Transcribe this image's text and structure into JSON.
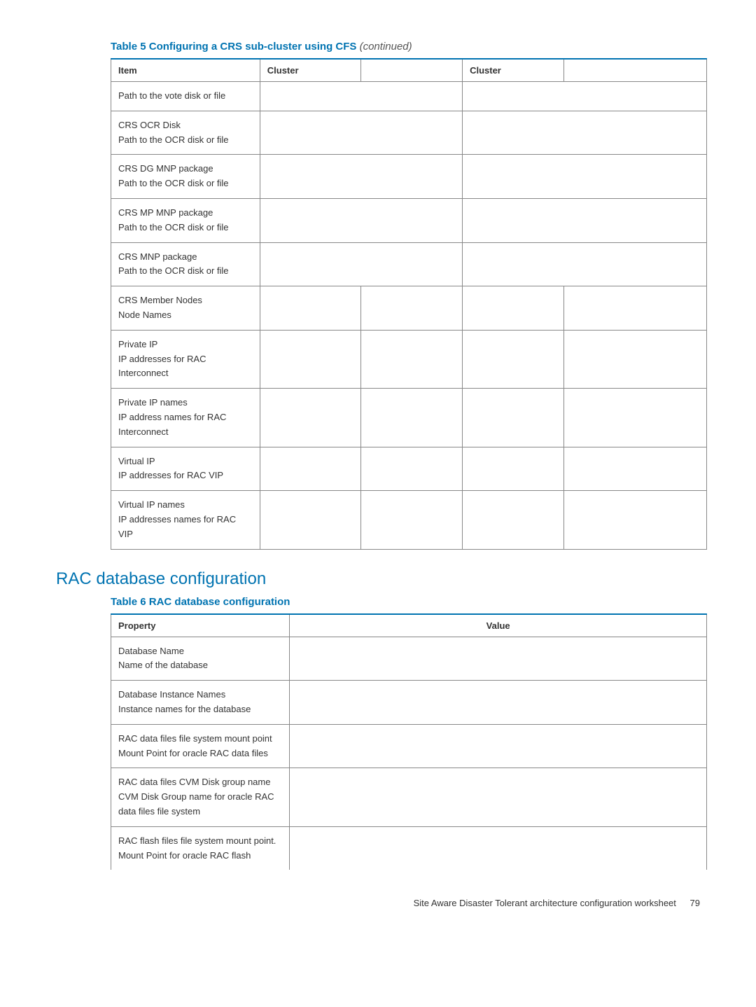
{
  "table5": {
    "caption": "Table 5 Configuring a CRS sub-cluster using CFS",
    "continued": "(continued)",
    "headers": {
      "item": "Item",
      "cluster1": "Cluster",
      "cluster2": "Cluster"
    },
    "rows": [
      {
        "main": "",
        "sub": "Path to the vote disk or file"
      },
      {
        "main": "CRS OCR Disk",
        "sub": "Path to the OCR disk or file"
      },
      {
        "main": "CRS DG MNP package",
        "sub": "Path to the OCR disk or file"
      },
      {
        "main": "CRS MP MNP package",
        "sub": "Path to the OCR disk or file"
      },
      {
        "main": "CRS MNP package",
        "sub": "Path to the OCR disk or file"
      },
      {
        "main": "CRS Member Nodes",
        "sub": "Node Names"
      },
      {
        "main": "Private IP",
        "sub": "IP addresses for RAC Interconnect"
      },
      {
        "main": "Private IP names",
        "sub": "IP address names for RAC Interconnect"
      },
      {
        "main": "Virtual IP",
        "sub": "IP addresses for RAC VIP"
      },
      {
        "main": "Virtual IP names",
        "sub": "IP addresses names for RAC VIP"
      }
    ]
  },
  "section_heading": "RAC database configuration",
  "table6": {
    "caption": "Table 6 RAC database configuration",
    "headers": {
      "property": "Property",
      "value": "Value"
    },
    "rows": [
      {
        "main": "Database Name",
        "sub": "Name of the database"
      },
      {
        "main": "Database Instance Names",
        "sub": "Instance names for the database"
      },
      {
        "main": "RAC data files file system mount point",
        "sub": "Mount Point for oracle RAC data files"
      },
      {
        "main": "RAC data files CVM Disk group name",
        "sub": "CVM Disk Group name for oracle RAC data files file system"
      },
      {
        "main": "RAC flash files file system mount point.",
        "sub": "Mount Point for oracle RAC flash"
      }
    ]
  },
  "footer": {
    "text": "Site Aware Disaster Tolerant architecture configuration worksheet",
    "page": "79"
  }
}
